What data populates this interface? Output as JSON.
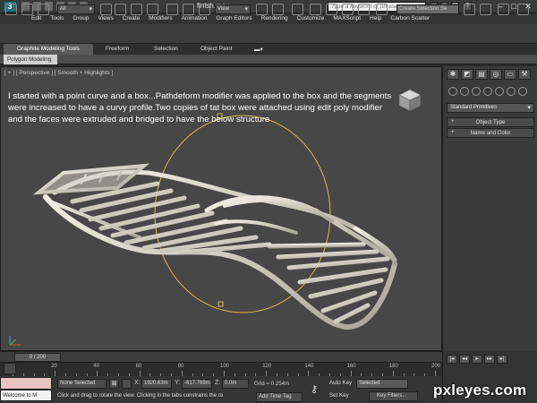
{
  "window": {
    "title": "finish.max",
    "app_logo_letter": "3"
  },
  "search": {
    "placeholder": "Type a keyword or phrase"
  },
  "menu": [
    "Edit",
    "Tools",
    "Group",
    "Views",
    "Create",
    "Modifiers",
    "Animation",
    "Graph Editors",
    "Rendering",
    "Customize",
    "MAXScript",
    "Help",
    "Carbon Scatter"
  ],
  "toolbar": {
    "selection_filter": "All",
    "reference_coord": "View",
    "create_selection_set": "Create Selection Se"
  },
  "ribbon": {
    "tabs": [
      "Graphite Modeling Tools",
      "Freeform",
      "Selection",
      "Object Paint"
    ],
    "active_tab": "Graphite Modeling Tools",
    "sub_tab": "Polygon Modeling"
  },
  "viewport": {
    "label": "[ + ] [ Perspective ] [ Smooth + Highlights ]",
    "caption": "I started with a point curve and a box...Pathdeform modifier was applied to the box and the segments were increased to have a curvy profile.Two copies of tat box were attached using edit poly modifier and the faces were extruded and bridged to have the below structure"
  },
  "command_panel": {
    "primitive_type": "Standard Primitives",
    "rollouts": [
      {
        "sign": "+",
        "label": "Object Type"
      },
      {
        "sign": "+",
        "label": "Name and Color"
      }
    ]
  },
  "timeline": {
    "frame_display": "0 / 200",
    "ticks": [
      "0",
      "20",
      "40",
      "60",
      "80",
      "100",
      "120",
      "140",
      "160",
      "180",
      "200"
    ]
  },
  "status": {
    "selection": "None Selected",
    "x_label": "X:",
    "x_value": "1920.63m",
    "y_label": "Y:",
    "y_value": "-617.769m",
    "z_label": "Z:",
    "z_value": "0.0m",
    "grid": "Grid = 0.254m",
    "prompt": "Click and drag to rotate the view.  Clicking in the tabs constrains the ro",
    "welcome": "Welcome to M",
    "add_time_tag": "Add Time Tag",
    "auto_key": "Auto Key",
    "set_key": "Set Key",
    "key_mode": "Selected",
    "key_filters": "Key Filters..."
  },
  "watermark": "pxleyes.com",
  "colors": {
    "viewport_bg": "#474747",
    "model": "#d9d6cc",
    "gizmo": "#e1b84a"
  }
}
